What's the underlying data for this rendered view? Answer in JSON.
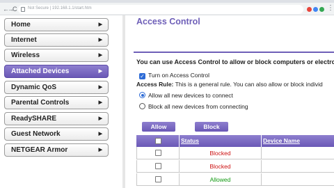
{
  "browser": {
    "url_prefix": "Not Secure",
    "url_text": "192.168.1.1/start.htm",
    "back_label": "←",
    "forward_label": "→",
    "reload_label": "C",
    "menu_label": "⋮",
    "extension_colors": [
      "#e8453c",
      "#4285f4",
      "#34a853",
      "#fbbc05"
    ]
  },
  "sidebar": {
    "items": [
      {
        "label": "Home",
        "active": false
      },
      {
        "label": "Internet",
        "active": false
      },
      {
        "label": "Wireless",
        "active": false
      },
      {
        "label": "Attached Devices",
        "active": true
      },
      {
        "label": "Dynamic QoS",
        "active": false
      },
      {
        "label": "Parental Controls",
        "active": false
      },
      {
        "label": "ReadySHARE",
        "active": false
      },
      {
        "label": "Guest Network",
        "active": false
      },
      {
        "label": "NETGEAR Armor",
        "active": false
      }
    ],
    "chevron": "▶"
  },
  "main": {
    "title": "Access Control",
    "intro": "You can use Access Control to allow or block computers or electro",
    "turn_on_label": "Turn on Access Control",
    "turn_on_checked": true,
    "access_rule_label": "Access Rule:",
    "access_rule_text": "This is a general rule. You can also allow or block individ",
    "radio_allow": "Allow all new devices to connect",
    "radio_block": "Block all new devices from connecting",
    "selected_rule": "allow",
    "allow_button": "Allow",
    "block_button": "Block"
  },
  "table": {
    "columns": [
      "",
      "Status",
      "Device Name"
    ],
    "rows": [
      {
        "status": "Blocked",
        "color": "#cc1111"
      },
      {
        "status": "Blocked",
        "color": "#cc1111"
      },
      {
        "status": "Allowed",
        "color": "#119911"
      }
    ]
  },
  "colors": {
    "accent": "#6e5fb8",
    "blocked": "#cc1111",
    "allowed": "#119911"
  }
}
